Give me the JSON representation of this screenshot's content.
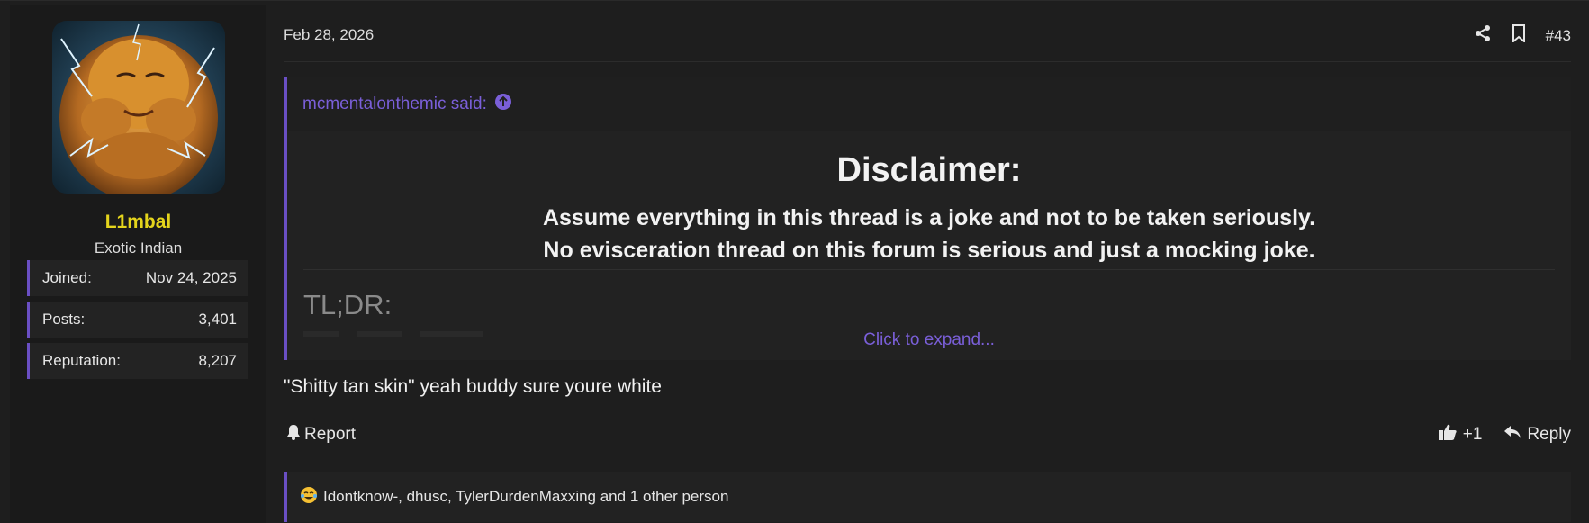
{
  "user": {
    "username": "L1mbal",
    "title": "Exotic Indian",
    "username_color": "#e4d41c",
    "stats": [
      {
        "label": "Joined:",
        "value": "Nov 24, 2025"
      },
      {
        "label": "Posts:",
        "value": "3,401"
      },
      {
        "label": "Reputation:",
        "value": "8,207"
      }
    ]
  },
  "post": {
    "date": "Feb 28, 2026",
    "number": "#43",
    "quote": {
      "author_line": "mcmentalonthemic said:",
      "title": "Disclaimer:",
      "line1": "Assume everything in this thread is a joke and not to be taken seriously.",
      "line2": "No evisceration thread on this forum is serious and just a mocking joke.",
      "tldr": "TL;DR:",
      "expand": "Click to expand..."
    },
    "message": "\"Shitty tan skin\" yeah buddy sure youre white",
    "report_label": "Report",
    "like_count": "+1",
    "reply_label": "Reply",
    "reactions_text": "Idontknow-, dhusc, TylerDurdenMaxxing and 1 other person"
  },
  "colors": {
    "accent": "#6a4fc4",
    "link": "#7a5fd8"
  },
  "icons": {
    "share": "share-icon",
    "bookmark": "bookmark-icon",
    "quote_arrow": "arrow-up-circle-icon",
    "report": "bell-icon",
    "like": "thumbs-up-icon",
    "reply": "reply-icon",
    "reaction": "laughing-crying-emoji-icon"
  }
}
